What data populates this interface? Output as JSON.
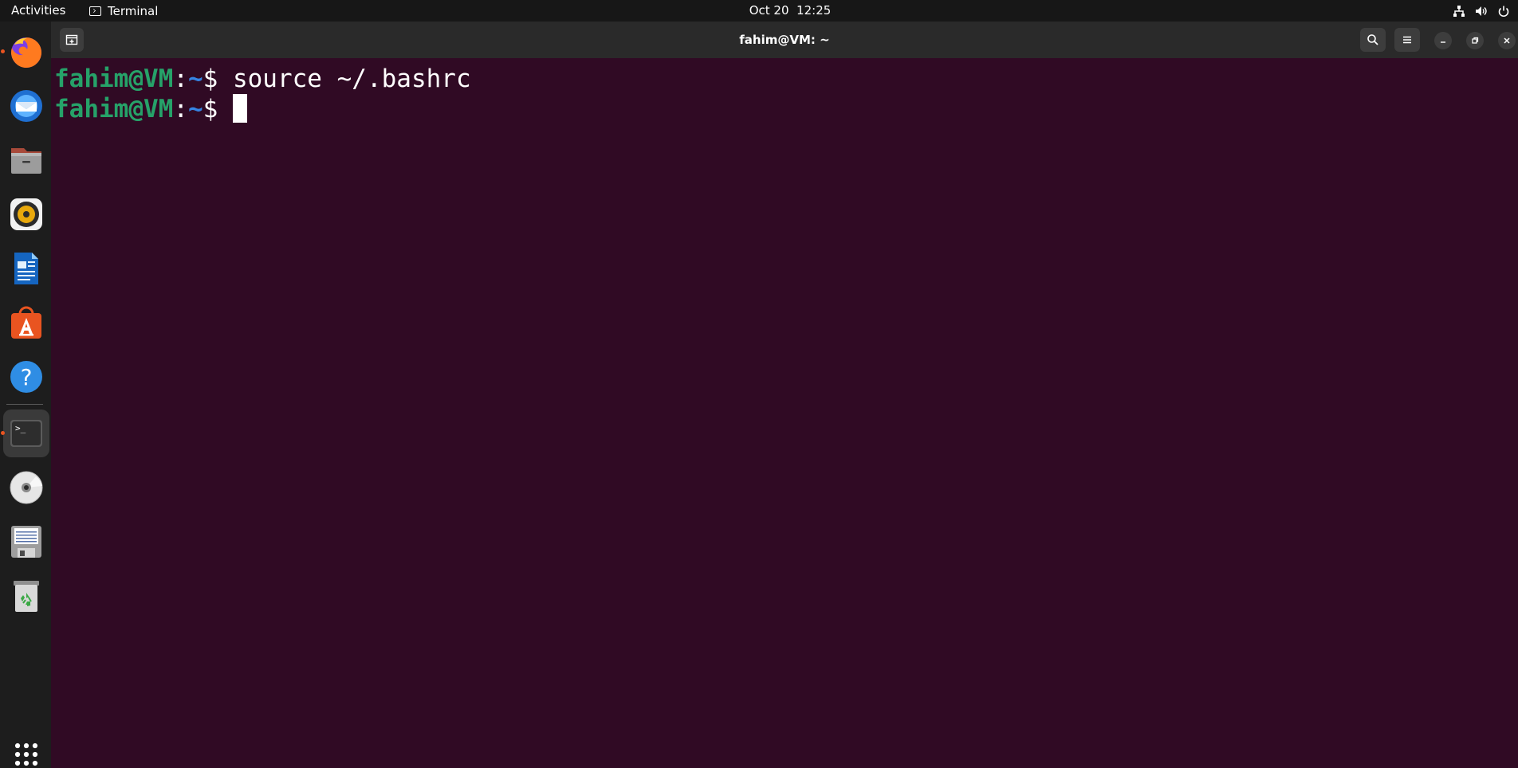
{
  "topbar": {
    "activities": "Activities",
    "app_name": "Terminal",
    "date": "Oct 20",
    "time": "12:25",
    "tray": [
      "network-icon",
      "volume-icon",
      "power-icon"
    ]
  },
  "dock": {
    "items": [
      {
        "name": "firefox",
        "icon": "firefox-icon",
        "running": true
      },
      {
        "name": "thunderbird",
        "icon": "thunderbird-icon",
        "running": false
      },
      {
        "name": "files",
        "icon": "files-icon",
        "running": false
      },
      {
        "name": "rhythmbox",
        "icon": "rhythmbox-icon",
        "running": false
      },
      {
        "name": "libreoffice-writer",
        "icon": "writer-icon",
        "running": false
      },
      {
        "name": "app-center",
        "icon": "app-center-icon",
        "running": false
      },
      {
        "name": "help",
        "icon": "help-icon",
        "running": false
      },
      {
        "name": "terminal",
        "icon": "terminal-icon",
        "running": true,
        "active": true
      },
      {
        "name": "optical-drive",
        "icon": "disc-icon",
        "running": false
      },
      {
        "name": "floppy",
        "icon": "floppy-icon",
        "running": false
      },
      {
        "name": "trash",
        "icon": "trash-icon",
        "running": false
      },
      {
        "name": "show-apps",
        "icon": "app-grid-icon",
        "running": false
      }
    ],
    "terminal_glyph": ">_",
    "help_glyph": "?"
  },
  "window": {
    "title": "fahim@VM: ~",
    "buttons": [
      "new-tab-icon",
      "search-icon",
      "hamburger-menu-icon",
      "minimize-icon",
      "restore-icon",
      "close-icon"
    ]
  },
  "terminal": {
    "lines": [
      {
        "user": "fahim@VM",
        "sep": ":",
        "path": "~",
        "prompt": "$ ",
        "command": "source ~/.bashrc"
      },
      {
        "user": "fahim@VM",
        "sep": ":",
        "path": "~",
        "prompt": "$ ",
        "command": ""
      }
    ]
  },
  "colors": {
    "terminal_bg": "#300a24",
    "prompt_user": "#26a269",
    "prompt_path": "#3584e4",
    "accent": "#e95420"
  }
}
